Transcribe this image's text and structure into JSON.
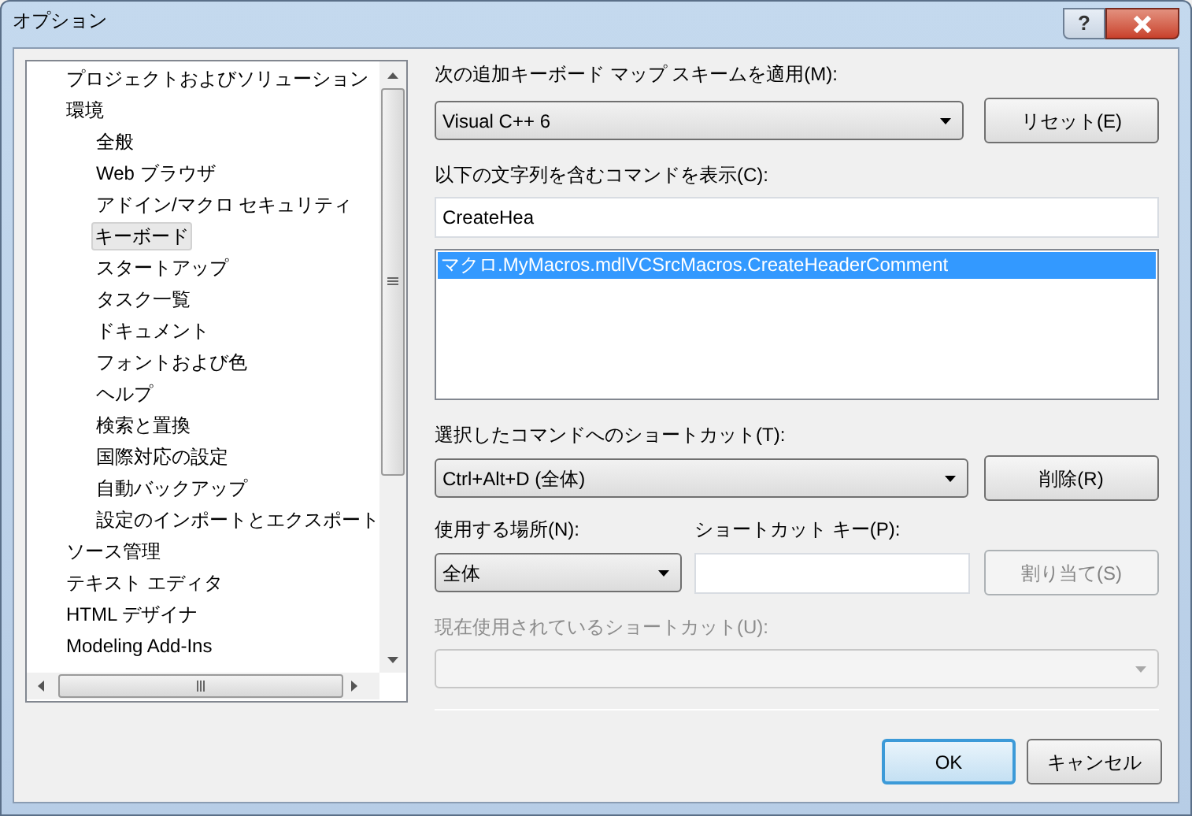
{
  "window": {
    "title": "オプション",
    "help_button": "?"
  },
  "tree": [
    {
      "label": "プロジェクトおよびソリューション",
      "selected": false
    },
    {
      "label": "環境",
      "selected": false,
      "children": [
        {
          "label": "全般",
          "selected": false
        },
        {
          "label": "Web ブラウザ",
          "selected": false
        },
        {
          "label": "アドイン/マクロ セキュリティ",
          "selected": false
        },
        {
          "label": "キーボード",
          "selected": true
        },
        {
          "label": "スタートアップ",
          "selected": false
        },
        {
          "label": "タスク一覧",
          "selected": false
        },
        {
          "label": "ドキュメント",
          "selected": false
        },
        {
          "label": "フォントおよび色",
          "selected": false
        },
        {
          "label": "ヘルプ",
          "selected": false
        },
        {
          "label": "検索と置換",
          "selected": false
        },
        {
          "label": "国際対応の設定",
          "selected": false
        },
        {
          "label": "自動バックアップ",
          "selected": false
        },
        {
          "label": "設定のインポートとエクスポート",
          "selected": false
        }
      ]
    },
    {
      "label": "ソース管理",
      "selected": false
    },
    {
      "label": "テキスト エディタ",
      "selected": false
    },
    {
      "label": "HTML デザイナ",
      "selected": false
    },
    {
      "label": "Modeling Add-Ins",
      "selected": false
    }
  ],
  "keyboard_scheme": {
    "label": "次の追加キーボード マップ スキームを適用(M):",
    "value": "Visual C++ 6"
  },
  "reset_button": {
    "label": "リセット(E)",
    "disabled": false
  },
  "command_filter": {
    "label": "以下の文字列を含むコマンドを表示(C):",
    "value": "CreateHea"
  },
  "command_list": [
    {
      "label": "マクロ.MyMacros.mdlVCSrcMacros.CreateHeaderComment",
      "selected": true
    }
  ],
  "shortcut": {
    "label": "選択したコマンドへのショートカット(T):",
    "value": "Ctrl+Alt+D (全体)"
  },
  "remove_button": {
    "label": "削除(R)",
    "disabled": false
  },
  "use_in": {
    "label": "使用する場所(N):",
    "value": "全体"
  },
  "shortcut_key": {
    "label": "ショートカット キー(P):"
  },
  "assign_button": {
    "label": "割り当て(S)",
    "disabled": true
  },
  "current_shortcut": {
    "label": "現在使用されているショートカット(U):",
    "disabled": true
  },
  "ok_button": {
    "label": "OK",
    "default": true
  },
  "cancel_button": {
    "label": "キャンセル",
    "default": false
  }
}
